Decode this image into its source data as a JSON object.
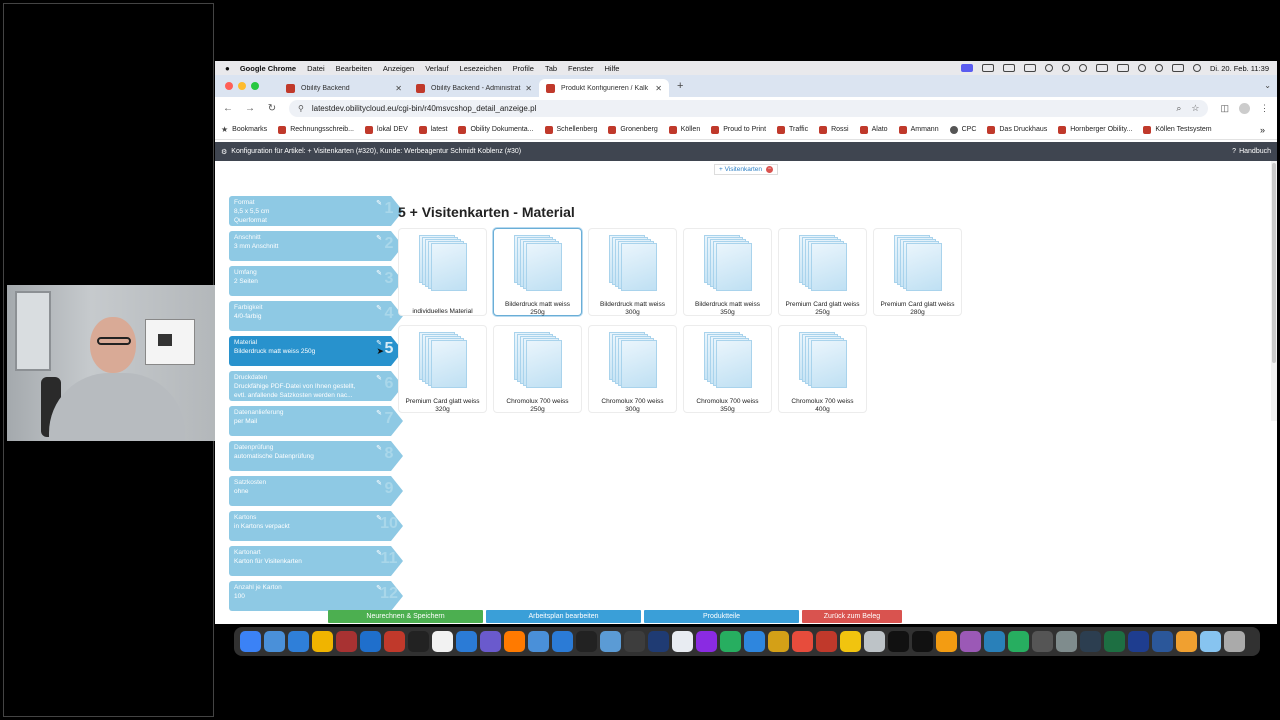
{
  "macmenu": {
    "items": [
      "Google Chrome",
      "Datei",
      "Bearbeiten",
      "Anzeigen",
      "Verlauf",
      "Lesezeichen",
      "Profile",
      "Tab",
      "Fenster",
      "Hilfe"
    ],
    "clock": "Di. 20. Feb. 11:39"
  },
  "tabs": [
    {
      "title": "Obility Backend",
      "active": false
    },
    {
      "title": "Obility Backend - Administrat",
      "active": false
    },
    {
      "title": "Produkt Konfigurieren / Kalk",
      "active": true
    }
  ],
  "url": "latestdev.obilitycloud.eu/cgi-bin/r40msvcshop_detail_anzeige.pl",
  "bookmarks": [
    "Bookmarks",
    "Rechnungsschreib...",
    "lokal DEV",
    "latest",
    "Obility Dokumenta...",
    "Schellenberg",
    "Gronenberg",
    "Köllen",
    "Proud to Print",
    "Traffic",
    "Rossi",
    "Alato",
    "Ammann",
    "CPC",
    "Das Druckhaus",
    "Hornberger Obility...",
    "Köllen Testsystem"
  ],
  "page": {
    "header": "Konfiguration für Artikel: + Visitenkarten (#320), Kunde: Werbeagentur Schmidt Koblenz (#30)",
    "handbuch": "Handbuch",
    "article_tag": "+ Visitenkarten",
    "title": "5 + Visitenkarten - Material"
  },
  "steps": [
    {
      "num": "1",
      "label": "Format",
      "value": "8,5 x 5,5 cm",
      "value2": "Querformat"
    },
    {
      "num": "2",
      "label": "Anschnitt",
      "value": "3 mm Anschnitt",
      "value2": ""
    },
    {
      "num": "3",
      "label": "Umfang",
      "value": "2 Seiten",
      "value2": ""
    },
    {
      "num": "4",
      "label": "Farbigkeit",
      "value": "4/0-farbig",
      "value2": ""
    },
    {
      "num": "5",
      "label": "Material",
      "value": "Bilderdruck matt weiss 250g",
      "value2": ""
    },
    {
      "num": "6",
      "label": "Druckdaten",
      "value": "Druckfähige PDF-Datei von Ihnen gestellt,",
      "value2": "evtl. anfallende Satzkosten werden nac..."
    },
    {
      "num": "7",
      "label": "Datenanlieferung",
      "value": "per Mail",
      "value2": ""
    },
    {
      "num": "8",
      "label": "Datenprüfung",
      "value": "automatische Datenprüfung",
      "value2": ""
    },
    {
      "num": "9",
      "label": "Satzkosten",
      "value": "ohne",
      "value2": ""
    },
    {
      "num": "10",
      "label": "Kartons",
      "value": "in Kartons verpackt",
      "value2": ""
    },
    {
      "num": "11",
      "label": "Kartonart",
      "value": "Karton für Visitenkarten",
      "value2": ""
    },
    {
      "num": "12",
      "label": "Anzahl je Karton",
      "value": "100",
      "value2": ""
    }
  ],
  "materials": [
    {
      "line1": "individuelles Material",
      "line2": ""
    },
    {
      "line1": "Bilderdruck matt weiss",
      "line2": "250g"
    },
    {
      "line1": "Bilderdruck matt weiss",
      "line2": "300g"
    },
    {
      "line1": "Bilderdruck matt weiss",
      "line2": "350g"
    },
    {
      "line1": "Premium Card glatt weiss",
      "line2": "250g"
    },
    {
      "line1": "Premium Card glatt weiss",
      "line2": "280g"
    },
    {
      "line1": "Premium Card glatt weiss",
      "line2": "320g"
    },
    {
      "line1": "Chromolux 700 weiss",
      "line2": "250g"
    },
    {
      "line1": "Chromolux 700 weiss",
      "line2": "300g"
    },
    {
      "line1": "Chromolux 700 weiss",
      "line2": "350g"
    },
    {
      "line1": "Chromolux 700 weiss",
      "line2": "400g"
    }
  ],
  "buttons": {
    "recalc": "Neurechnen & Speichern",
    "workplan": "Arbeitsplan bearbeiten",
    "parts": "Produktteile",
    "back": "Zurück zum Beleg"
  },
  "colors": {
    "active_step": "#2892cd",
    "step": "#8ec9e4",
    "header_bar": "#3f4550"
  }
}
